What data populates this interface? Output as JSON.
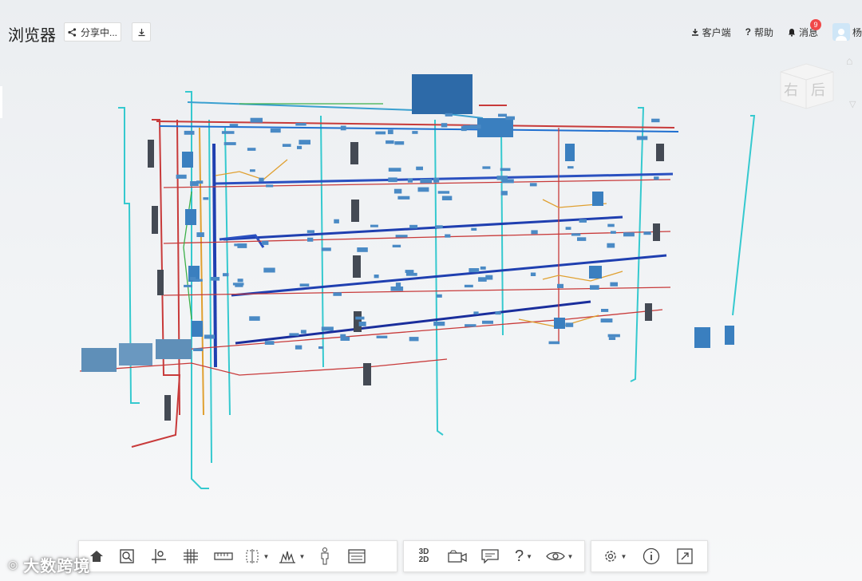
{
  "app": {
    "title": "浏览器"
  },
  "header": {
    "share_label": "分享中...",
    "client_label": "客户端",
    "help_label": "帮助",
    "messages_label": "消息",
    "messages_count": "9",
    "user_label": "杨"
  },
  "viewcube": {
    "face_right": "右",
    "face_back": "后"
  },
  "toolbar": {
    "groups": [
      [
        "home-icon",
        "zoom-fit-icon",
        "locate-icon",
        "grid-icon",
        "measure-icon",
        "section-box-icon",
        "explode-icon",
        "person-icon",
        "properties-icon"
      ],
      [
        "view-3d-2d-icon",
        "camera-icon",
        "comment-icon",
        "help-icon",
        "visibility-icon"
      ],
      [
        "settings-icon",
        "info-icon",
        "fullscreen-icon"
      ]
    ],
    "label_3d": "3D",
    "label_2d": "2D"
  },
  "watermark": {
    "text": "大数跨境"
  },
  "colors": {
    "accent": "#1890ff",
    "pipe_red": "#c83a3a",
    "pipe_cyan": "#35c9cf",
    "duct_blue": "#1f3fb0",
    "badge": "#f04848"
  }
}
